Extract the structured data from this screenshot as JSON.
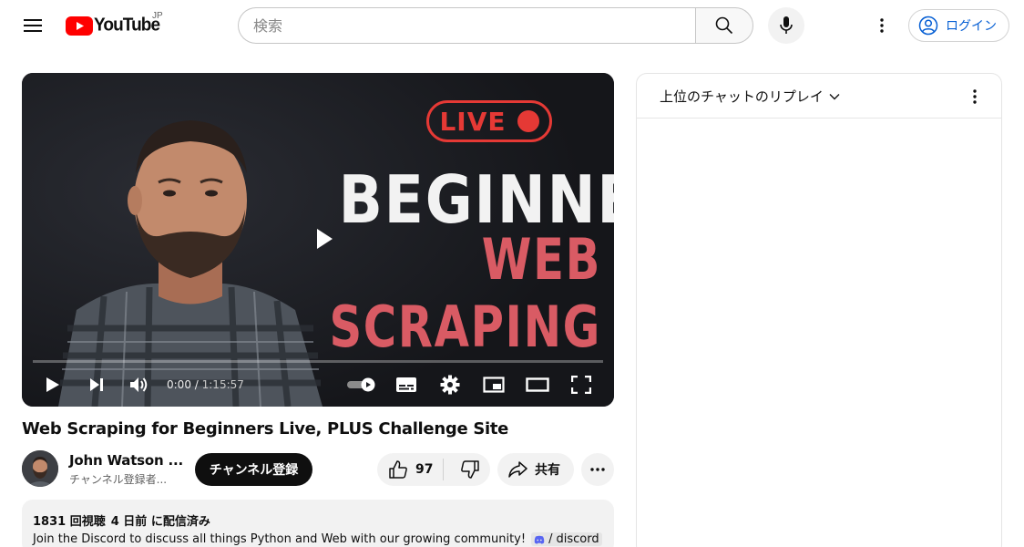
{
  "header": {
    "logo_text": "YouTube",
    "country_code": "JP",
    "search_placeholder": "検索",
    "login_label": "ログイン"
  },
  "player": {
    "thumbnail": {
      "live_text": "LIVE",
      "headline_line1": "BEGINNER",
      "headline_line2": "WEB SCRAPING"
    },
    "current_time": "0:00",
    "duration": "1:15:57",
    "progress": 0
  },
  "video": {
    "title": "Web Scraping for Beginners Live, PLUS Challenge Site"
  },
  "owner": {
    "channel_name": "John Watson ...",
    "subscribers": "チャンネル登録者...",
    "subscribe_label": "チャンネル登録"
  },
  "actions": {
    "like_count": "97",
    "share_label": "共有"
  },
  "description": {
    "views": "1831 回視聴",
    "date": "4 日前 に配信済み",
    "text": "Join the Discord to discuss all things Python and Web with our growing community!",
    "link_sep": "/",
    "link_text": "discord"
  },
  "chat": {
    "title": "上位のチャットのリプレイ"
  },
  "colors": {
    "brand_red": "#ff0000",
    "live_red": "#e53935",
    "headline_red": "#d95b64",
    "link_blue": "#065fd4",
    "discord_blue": "#5865f2"
  }
}
